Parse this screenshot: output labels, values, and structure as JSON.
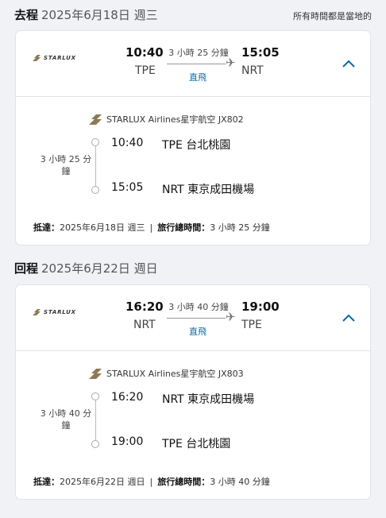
{
  "note": "所有時間都是當地的",
  "outbound": {
    "label": "去程",
    "date": "2025年6月18日 週三",
    "dep_time": "10:40",
    "arr_time": "15:05",
    "dep_code": "TPE",
    "arr_code": "NRT",
    "duration": "3 小時 25 分鐘",
    "stops": "直飛",
    "airline": "STARLUX Airlines星宇航空 JX802",
    "side_duration": "3 小時 25 分鐘",
    "seg_dep_time": "10:40",
    "seg_dep_place": "TPE 台北桃園",
    "seg_arr_time": "15:05",
    "seg_arr_place": "NRT 東京成田機場",
    "arrive_label": "抵達：",
    "arrive_value": "2025年6月18日 週三",
    "separator": "|",
    "total_label": "旅行總時間：",
    "total_value": "3 小時 25 分鐘"
  },
  "return": {
    "label": "回程",
    "date": "2025年6月22日 週日",
    "dep_time": "16:20",
    "arr_time": "19:00",
    "dep_code": "NRT",
    "arr_code": "TPE",
    "duration": "3 小時 40 分鐘",
    "stops": "直飛",
    "airline": "STARLUX Airlines星宇航空 JX803",
    "side_duration": "3 小時 40 分鐘",
    "seg_dep_time": "16:20",
    "seg_dep_place": "NRT 東京成田機場",
    "seg_arr_time": "19:00",
    "seg_arr_place": "TPE 台北桃園",
    "arrive_label": "抵達：",
    "arrive_value": "2025年6月22日 週日",
    "separator": "|",
    "total_label": "旅行總時間：",
    "total_value": "3 小時 40 分鐘"
  },
  "logo_text": "STARLUX",
  "colors": {
    "accent": "#0a6aa8",
    "page_bg": "#f0f2f5"
  },
  "icons": {
    "plane": "plane-icon",
    "chevron": "chevron-up-icon",
    "airline": "starlux-logo-icon"
  }
}
